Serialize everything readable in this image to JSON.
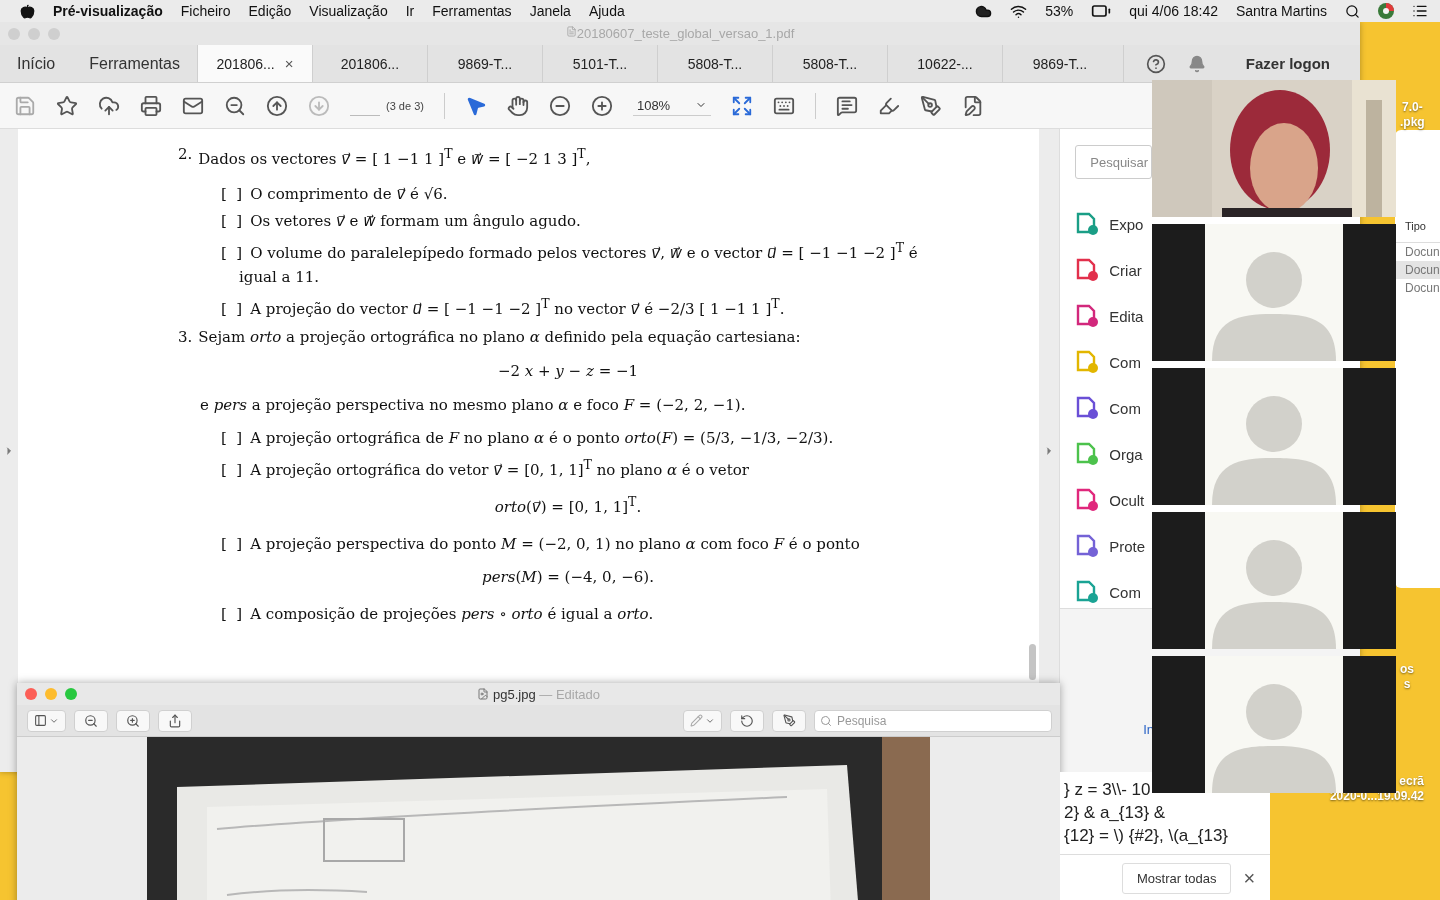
{
  "menu_bar": {
    "app": "Pré-visualização",
    "items": [
      "Ficheiro",
      "Edição",
      "Visualização",
      "Ir",
      "Ferramentas",
      "Janela",
      "Ajuda"
    ],
    "battery": "53%",
    "clock": "qui 4/06 18:42",
    "user": "Santra Martins"
  },
  "acrobat": {
    "title": "20180607_teste_global_versao_1.pdf",
    "nav": [
      "Início",
      "Ferramentas"
    ],
    "tabs": [
      {
        "label": "201806...",
        "selected": true
      },
      {
        "label": "201806...",
        "selected": false
      },
      {
        "label": "9869-T...",
        "selected": false
      },
      {
        "label": "5101-T...",
        "selected": false
      },
      {
        "label": "5808-T...",
        "selected": false
      },
      {
        "label": "5808-T...",
        "selected": false
      },
      {
        "label": "10622-...",
        "selected": false
      },
      {
        "label": "9869-T...",
        "selected": false
      }
    ],
    "tab_close": "×",
    "sign_in": "Fazer logon",
    "page": "(3 de 3)",
    "zoom": "108%",
    "document": [
      {
        "kind": "question",
        "number": "2.",
        "text": "Dados os vectores *v⃗* = [ 1 −1 1 ]$^{T}$ e *w⃗* = [ −2 1 3 ]$^{T}$,"
      },
      {
        "kind": "option",
        "box": "[  ]",
        "text": "O comprimento de *v⃗* é √6."
      },
      {
        "kind": "option",
        "box": "[  ]",
        "text": "Os vetores *v⃗* e *w⃗* formam um ângulo agudo."
      },
      {
        "kind": "option",
        "box": "[  ]",
        "text": "O volume do paralelepípedo formado pelos vectores *v⃗*, *w⃗* e o vector *u⃗* = [ −1 −1 −2 ]$^{T}$ é igual a 11."
      },
      {
        "kind": "option",
        "box": "[  ]",
        "text": "A projeção do vector *u⃗* = [ −1 −1 −2 ]$^{T}$ no vector *v⃗* é −2/3 [ 1 −1 1 ]$^{T}$."
      },
      {
        "kind": "question",
        "number": "3.",
        "text": "Sejam *orto* a projeção ortográfica no plano *α* definido pela equação cartesiana:"
      },
      {
        "kind": "equation",
        "text": "−2 *x* + *y* − *z* = −1"
      },
      {
        "kind": "paragraph",
        "text": "e *pers* a projeção perspectiva no mesmo plano *α* e foco *F* = (−2, 2, −1)."
      },
      {
        "kind": "option",
        "box": "[  ]",
        "text": "A projeção ortográfica de *F* no plano *α* é o ponto *orto*(*F*) = (5/3, −1/3, −2/3)."
      },
      {
        "kind": "option",
        "box": "[  ]",
        "text": "A projeção ortográfica do vetor *v⃗* = [0, 1, 1]$^{T}$ no plano *α* é o vetor"
      },
      {
        "kind": "equation",
        "text": "*orto*(*v⃗*) = [0, 1, 1]$^{T}$."
      },
      {
        "kind": "option",
        "box": "[  ]",
        "text": "A projeção perspectiva do ponto *M* = (−2, 0, 1) no plano *α* com foco *F* é o ponto"
      },
      {
        "kind": "equation",
        "text": "*pers*(*M*) = (−4, 0, −6)."
      },
      {
        "kind": "option",
        "box": "[  ]",
        "text": "A composição de projeções *pers* ∘ *orto* é igual a *orto*."
      }
    ],
    "tools_pane": {
      "search_placeholder": "Pesquisar",
      "tools": [
        {
          "label": "Expo",
          "color": "#1a9e86"
        },
        {
          "label": "Criar",
          "color": "#e2304c"
        },
        {
          "label": "Edita",
          "color": "#d2287c"
        },
        {
          "label": "Com",
          "color": "#e2b600"
        },
        {
          "label": "Com",
          "color": "#6a4fd6"
        },
        {
          "label": "Orga",
          "color": "#4cc24c"
        },
        {
          "label": "Ocult",
          "color": "#e0287c"
        },
        {
          "label": "Prote",
          "color": "#7462d6"
        },
        {
          "label": "Com",
          "color": "#1aa394"
        }
      ],
      "link": "In"
    }
  },
  "video_call": {
    "tiles": [
      {
        "kind": "camera"
      },
      {
        "kind": "avatar"
      },
      {
        "kind": "avatar"
      },
      {
        "kind": "avatar"
      },
      {
        "kind": "avatar"
      }
    ]
  },
  "finder": {
    "column": "Tipo",
    "rows": [
      {
        "label": "Docun",
        "selected": false
      },
      {
        "label": "Docun",
        "selected": true
      },
      {
        "label": "Docun",
        "selected": false
      }
    ]
  },
  "desktop_icons": [
    {
      "lines": [
        "7.0-",
        ".pkg"
      ]
    },
    {
      "lines": [
        "os",
        "s"
      ]
    },
    {
      "lines": [
        "ecrã",
        "2020-0...19.09.42"
      ]
    }
  ],
  "editor": {
    "lines": [
      "} z = 3\\\\- 10",
      "2} & a_{13} &",
      "{12} = \\) {#2}, \\(a_{13}"
    ],
    "button": "Mostrar todas",
    "close": "×"
  },
  "preview": {
    "title": "pg5.jpg",
    "status": "— Editado",
    "search_placeholder": "Pesquisa"
  }
}
